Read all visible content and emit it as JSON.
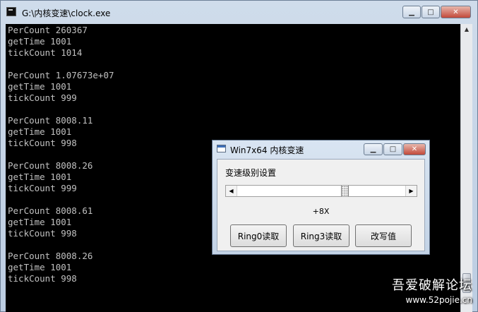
{
  "console": {
    "title": "G:\\内核变速\\clock.exe",
    "lines": [
      "PerCount 260367",
      "getTime 1001",
      "tickCount 1014",
      "",
      "PerCount 1.07673e+07",
      "getTime 1001",
      "tickCount 999",
      "",
      "PerCount 8008.11",
      "getTime 1001",
      "tickCount 998",
      "",
      "PerCount 8008.26",
      "getTime 1001",
      "tickCount 999",
      "",
      "PerCount 8008.61",
      "getTime 1001",
      "tickCount 998",
      "",
      "PerCount 8008.26",
      "getTime 1001",
      "tickCount 998"
    ]
  },
  "dialog": {
    "title": "Win7x64 内核变速",
    "speed_label": "变速级别设置",
    "slider_position": 0.64,
    "speed_value": "+8X",
    "buttons": {
      "ring0": "Ring0读取",
      "ring3": "Ring3读取",
      "modify": "改写值"
    }
  },
  "watermark": {
    "main": "吾爱破解论坛",
    "sub": "www.52pojie.cn"
  },
  "icons": {
    "minimize": "minimize-icon",
    "maximize": "maximize-icon",
    "close": "close-icon"
  }
}
